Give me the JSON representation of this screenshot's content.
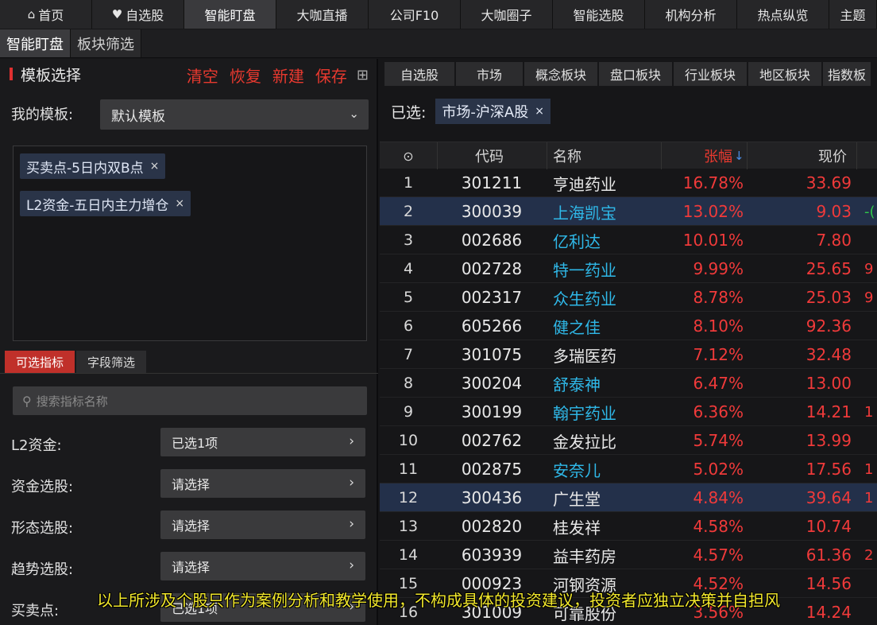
{
  "topnav": [
    {
      "label": "首页",
      "icon": "home-icon",
      "glyph": "⌂",
      "w": 116
    },
    {
      "label": "自选股",
      "icon": "heart-icon",
      "glyph": "♥",
      "w": 116
    },
    {
      "label": "智能盯盘",
      "w": 116,
      "active": true
    },
    {
      "label": "大咖直播",
      "w": 116
    },
    {
      "label": "公司F10",
      "w": 116
    },
    {
      "label": "大咖圈子",
      "w": 116
    },
    {
      "label": "智能选股",
      "w": 116
    },
    {
      "label": "机构分析",
      "w": 116
    },
    {
      "label": "热点纵览",
      "w": 116
    },
    {
      "label": "主题",
      "w": 60
    }
  ],
  "subtabs": [
    {
      "label": "智能盯盘",
      "active": true
    },
    {
      "label": "板块筛选",
      "active": false
    }
  ],
  "left": {
    "title": "模板选择",
    "actions": [
      "清空",
      "恢复",
      "新建",
      "保存"
    ],
    "grid_icon": "grid-icon",
    "my_template_label": "我的模板:",
    "template_value": "默认模板",
    "tags": [
      "买卖点-5日内双B点",
      "L2资金-五日内主力增仓"
    ],
    "tag_close": "×",
    "ind_tabs": [
      {
        "label": "可选指标",
        "active": true
      },
      {
        "label": "字段筛选",
        "active": false
      }
    ],
    "search_placeholder": "搜索指标名称",
    "filters": [
      {
        "label": "L2资金:",
        "value": "已选1项"
      },
      {
        "label": "资金选股:",
        "value": "请选择"
      },
      {
        "label": "形态选股:",
        "value": "请选择"
      },
      {
        "label": "趋势选股:",
        "value": "请选择"
      },
      {
        "label": "买卖点:",
        "value": "已选1项"
      }
    ]
  },
  "right": {
    "tabs": [
      {
        "label": "自选股",
        "w": 88
      },
      {
        "label": "市场",
        "w": 84
      },
      {
        "label": "概念板块",
        "w": 92
      },
      {
        "label": "盘口板块",
        "w": 92
      },
      {
        "label": "行业板块",
        "w": 92
      },
      {
        "label": "地区板块",
        "w": 92
      },
      {
        "label": "指数板",
        "w": 60
      }
    ],
    "selected_label": "已选:",
    "selected_tag": "市场-沪深A股",
    "columns": {
      "idx_icon": "settings-circle-icon",
      "code": "代码",
      "name": "名称",
      "chg": "张幅",
      "sort_arrow": "↓",
      "price": "现价"
    },
    "rows": [
      {
        "idx": "1",
        "code": "301211",
        "name": "亨迪药业",
        "blue": false,
        "chg": "16.78%",
        "price": "33.69",
        "extra": ""
      },
      {
        "idx": "2",
        "code": "300039",
        "name": "上海凯宝",
        "blue": true,
        "chg": "13.02%",
        "price": "9.03",
        "extra": "-(",
        "hl": true,
        "green": true
      },
      {
        "idx": "3",
        "code": "002686",
        "name": "亿利达",
        "blue": true,
        "chg": "10.01%",
        "price": "7.80",
        "extra": ""
      },
      {
        "idx": "4",
        "code": "002728",
        "name": "特一药业",
        "blue": true,
        "chg": "9.99%",
        "price": "25.65",
        "extra": "9"
      },
      {
        "idx": "5",
        "code": "002317",
        "name": "众生药业",
        "blue": true,
        "chg": "8.78%",
        "price": "25.03",
        "extra": "9"
      },
      {
        "idx": "6",
        "code": "605266",
        "name": "健之佳",
        "blue": true,
        "chg": "8.10%",
        "price": "92.36",
        "extra": ""
      },
      {
        "idx": "7",
        "code": "301075",
        "name": "多瑞医药",
        "blue": false,
        "chg": "7.12%",
        "price": "32.48",
        "extra": ""
      },
      {
        "idx": "8",
        "code": "300204",
        "name": "舒泰神",
        "blue": true,
        "chg": "6.47%",
        "price": "13.00",
        "extra": ""
      },
      {
        "idx": "9",
        "code": "300199",
        "name": "翰宇药业",
        "blue": true,
        "chg": "6.36%",
        "price": "14.21",
        "extra": "1"
      },
      {
        "idx": "10",
        "code": "002762",
        "name": "金发拉比",
        "blue": false,
        "chg": "5.74%",
        "price": "13.99",
        "extra": ""
      },
      {
        "idx": "11",
        "code": "002875",
        "name": "安奈儿",
        "blue": true,
        "chg": "5.02%",
        "price": "17.56",
        "extra": "1"
      },
      {
        "idx": "12",
        "code": "300436",
        "name": "广生堂",
        "blue": false,
        "chg": "4.84%",
        "price": "39.64",
        "extra": "1",
        "hl": true
      },
      {
        "idx": "13",
        "code": "002820",
        "name": "桂发祥",
        "blue": false,
        "chg": "4.58%",
        "price": "10.74",
        "extra": ""
      },
      {
        "idx": "14",
        "code": "603939",
        "name": "益丰药房",
        "blue": false,
        "chg": "4.57%",
        "price": "61.36",
        "extra": "2"
      },
      {
        "idx": "15",
        "code": "000923",
        "name": "河钢资源",
        "blue": false,
        "chg": "4.52%",
        "price": "14.56",
        "extra": ""
      },
      {
        "idx": "16",
        "code": "301009",
        "name": "可靠股份",
        "blue": false,
        "chg": "3.56%",
        "price": "14.24",
        "extra": ""
      }
    ]
  },
  "disclaimer": "以上所涉及个股只作为案例分析和教学使用，不构成具体的投资建议，投资者应独立决策并自担风",
  "colors": {
    "up": "#f03a3a",
    "accent": "#e8392f",
    "link": "#2fb8e8",
    "down": "#2fc84a",
    "disclaimer": "#f2e82c"
  }
}
